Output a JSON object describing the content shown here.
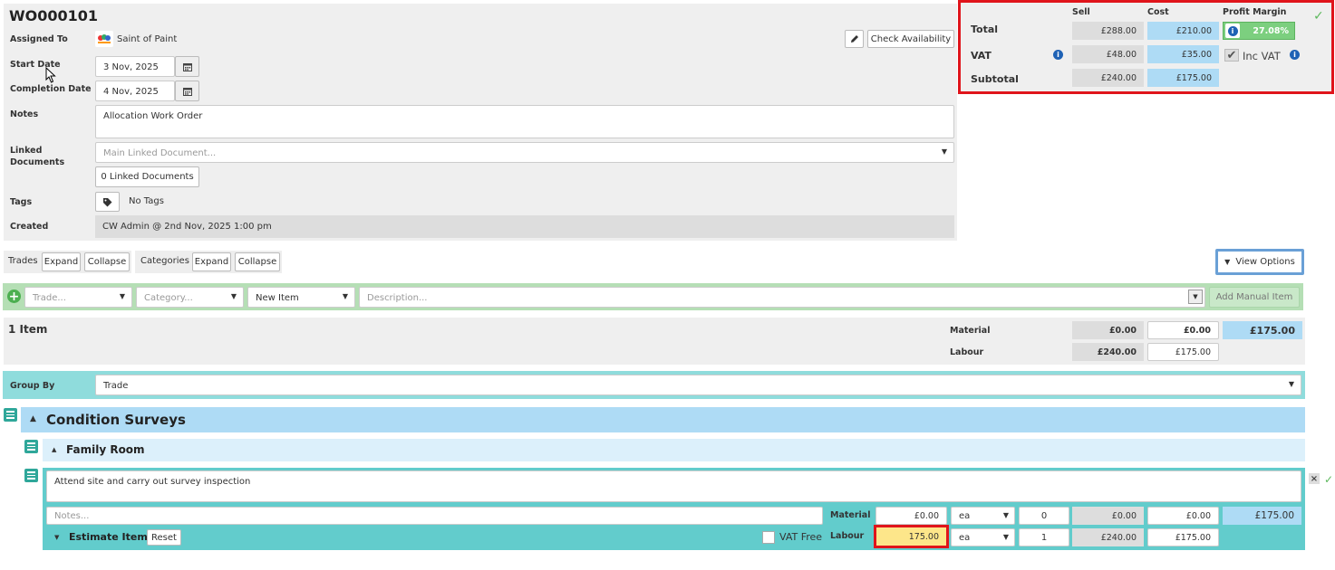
{
  "header": {
    "wo_number": "WO000101"
  },
  "form": {
    "assigned_label": "Assigned To",
    "assigned_value": "Saint of Paint",
    "start_label": "Start Date",
    "start_value": "3 Nov, 2025",
    "completion_label": "Completion Date",
    "completion_value": "4 Nov, 2025",
    "notes_label": "Notes",
    "notes_value": "Allocation Work Order",
    "linked_label_1": "Linked",
    "linked_label_2": "Documents",
    "linked_placeholder": "Main Linked Document...",
    "linked_count": "0 Linked Documents",
    "tags_label": "Tags",
    "tags_value": "No Tags",
    "created_label": "Created",
    "created_value": "CW Admin @ 2nd Nov, 2025 1:00 pm",
    "check_availability": "Check Availability"
  },
  "totals": {
    "col_sell": "Sell",
    "col_cost": "Cost",
    "col_margin": "Profit Margin",
    "total_label": "Total",
    "total_sell": "£288.00",
    "total_cost": "£210.00",
    "margin": "27.08%",
    "vat_label": "VAT",
    "vat_sell": "£48.00",
    "vat_cost": "£35.00",
    "inc_vat": "Inc VAT",
    "subtotal_label": "Subtotal",
    "subtotal_sell": "£240.00",
    "subtotal_cost": "£175.00",
    "highlight_color": "#e0141b"
  },
  "toolbar": {
    "trades_label": "Trades",
    "expand": "Expand",
    "collapse": "Collapse",
    "categories_label": "Categories",
    "view_options": "View Options"
  },
  "add_row": {
    "trade_placeholder": "Trade...",
    "category_placeholder": "Category...",
    "item_value": "New Item",
    "description_placeholder": "Description...",
    "add_manual": "Add Manual Item"
  },
  "summary": {
    "count": "1 Item",
    "material_label": "Material",
    "material_sell": "£0.00",
    "material_cost": "£0.00",
    "total_blue": "£175.00",
    "labour_label": "Labour",
    "labour_sell": "£240.00",
    "labour_cost": "£175.00"
  },
  "group": {
    "label": "Group By",
    "value": "Trade"
  },
  "tree": {
    "trade": "Condition Surveys",
    "category": "Family Room",
    "item": {
      "description": "Attend site and carry out survey inspection",
      "notes_placeholder": "Notes...",
      "title": "Estimate Item",
      "reset": "Reset",
      "vat_free": "VAT Free",
      "material_label": "Material",
      "material_rate": "£0.00",
      "material_unit": "ea",
      "material_qty": "0",
      "material_sell": "£0.00",
      "material_cost": "£0.00",
      "item_total": "£175.00",
      "labour_label": "Labour",
      "labour_rate": "175.00",
      "labour_unit": "ea",
      "labour_qty": "1",
      "labour_sell": "£240.00",
      "labour_cost": "£175.00"
    }
  }
}
